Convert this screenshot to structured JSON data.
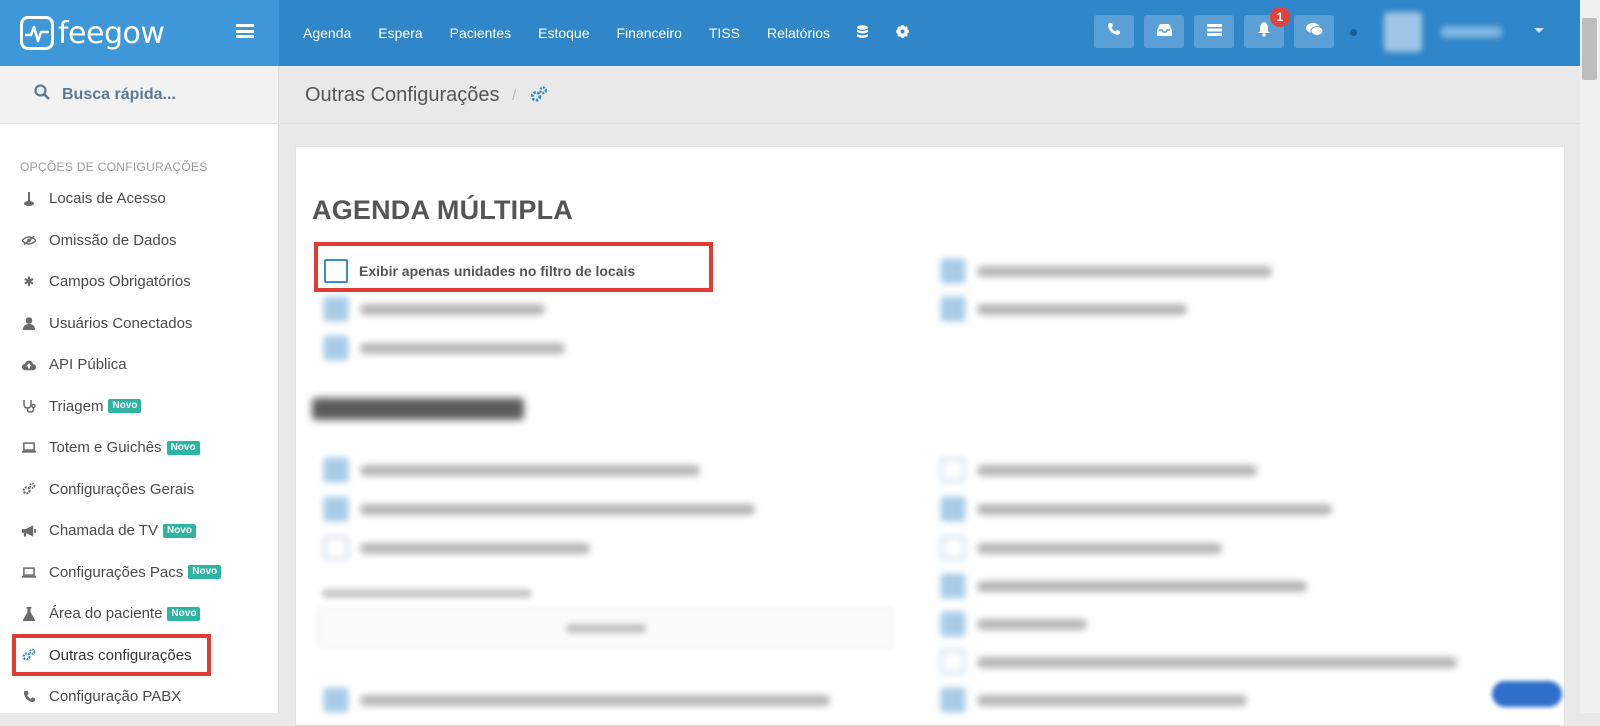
{
  "brand": {
    "name": "feegow"
  },
  "topnav": {
    "items": [
      "Agenda",
      "Espera",
      "Pacientes",
      "Estoque",
      "Financeiro",
      "TISS",
      "Relatórios"
    ],
    "icons": [
      "database-icon",
      "gear-icon"
    ]
  },
  "top_actions": {
    "icons": [
      "phone-icon",
      "inbox-icon",
      "server-icon",
      "bell-icon",
      "chat-icon"
    ],
    "notification_count": "1"
  },
  "search": {
    "label": "Busca rápida..."
  },
  "sidebar": {
    "section_title": "OPÇÕES DE CONFIGURAÇÕES",
    "items": [
      {
        "label": "Locais de Acesso",
        "icon": "location-icon",
        "novo": ""
      },
      {
        "label": "Omissão de Dados",
        "icon": "eye-slash-icon",
        "novo": ""
      },
      {
        "label": "Campos Obrigatórios",
        "icon": "asterisk-icon",
        "novo": ""
      },
      {
        "label": "Usuários Conectados",
        "icon": "user-icon",
        "novo": ""
      },
      {
        "label": "API Pública",
        "icon": "cloud-upload-icon",
        "novo": ""
      },
      {
        "label": "Triagem",
        "icon": "stethoscope-icon",
        "novo": "Novo"
      },
      {
        "label": "Totem e Guichês",
        "icon": "laptop-icon",
        "novo": "Novo"
      },
      {
        "label": "Configurações Gerais",
        "icon": "gears-icon",
        "novo": ""
      },
      {
        "label": "Chamada de TV",
        "icon": "bullhorn-icon",
        "novo": "Novo"
      },
      {
        "label": "Configurações Pacs",
        "icon": "laptop-icon",
        "novo": "Novo"
      },
      {
        "label": "Área do paciente",
        "icon": "flask-icon",
        "novo": "Novo"
      },
      {
        "label": "Outras configurações",
        "icon": "gears-icon",
        "novo": ""
      },
      {
        "label": "Configuração PABX",
        "icon": "phone-icon",
        "novo": ""
      }
    ]
  },
  "breadcrumb": {
    "title": "Outras Configurações",
    "separator": "/"
  },
  "panel": {
    "title": "AGENDA MÚLTIPLA",
    "option_1": {
      "label": "Exibir apenas unidades no filtro de locais",
      "checked": false
    }
  },
  "colors": {
    "topbar": "#2f86c8",
    "brand": "#3e98d8",
    "highlight": "#e13b34",
    "novo_badge": "#2cb5a0"
  }
}
